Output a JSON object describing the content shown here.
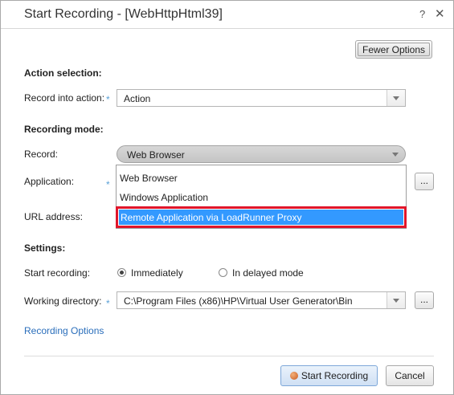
{
  "window": {
    "title": "Start Recording - [WebHttpHtml39]",
    "help_glyph": "?",
    "close_glyph": "✕"
  },
  "toolbar": {
    "fewer_options_label": "Fewer Options"
  },
  "action_selection": {
    "heading": "Action selection:",
    "record_into_label": "Record into action:",
    "record_into_value": "Action"
  },
  "recording_mode": {
    "heading": "Recording mode:",
    "record_label": "Record:",
    "record_value": "Web Browser",
    "application_label": "Application:",
    "url_label": "URL address:",
    "dropdown_options": [
      "Web Browser",
      "Windows Application",
      "Remote Application via LoadRunner Proxy"
    ],
    "highlighted_option": "Remote Application via LoadRunner Proxy"
  },
  "settings": {
    "heading": "Settings:",
    "start_recording_label": "Start recording:",
    "immediately_label": "Immediately",
    "delayed_label": "In delayed mode",
    "start_mode_selected": "Immediately",
    "working_dir_label": "Working directory:",
    "working_dir_value": "C:\\Program Files (x86)\\HP\\Virtual User Generator\\Bin"
  },
  "links": {
    "recording_options": "Recording Options"
  },
  "footer": {
    "start_recording_label": "Start Recording",
    "cancel_label": "Cancel"
  },
  "common": {
    "required_marker": "*",
    "browse_glyph": "..."
  },
  "colors": {
    "highlight_bg": "#3399ff",
    "highlight_border": "#e0162b",
    "link": "#2a6ebb",
    "required": "#5aa0d6"
  },
  "icons": {
    "help": "help-icon",
    "close": "close-icon",
    "dropdown": "chevron-down-icon",
    "record": "record-icon"
  }
}
